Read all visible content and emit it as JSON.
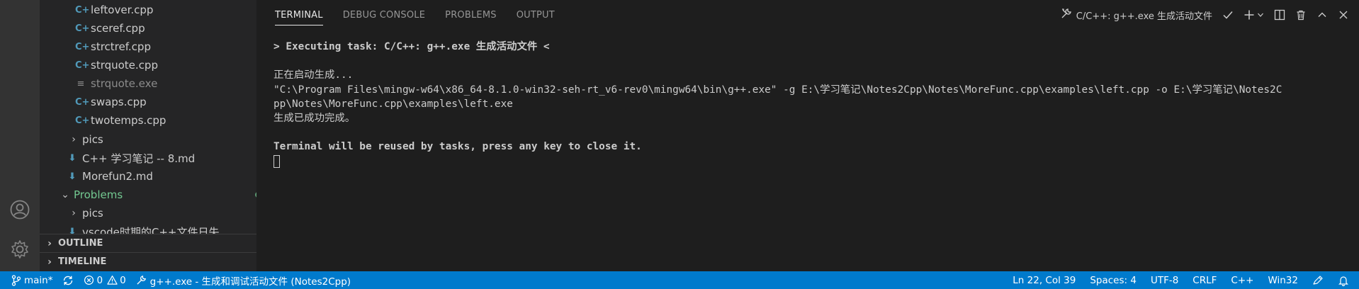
{
  "explorer": {
    "items": [
      {
        "label": "leftover.cpp",
        "icon": "cpp-file-icon",
        "level": 2
      },
      {
        "label": "sceref.cpp",
        "icon": "cpp-file-icon",
        "level": 2
      },
      {
        "label": "strctref.cpp",
        "icon": "cpp-file-icon",
        "level": 2
      },
      {
        "label": "strquote.cpp",
        "icon": "cpp-file-icon",
        "level": 2
      },
      {
        "label": "strquote.exe",
        "icon": "exe-file-icon",
        "level": 2
      },
      {
        "label": "swaps.cpp",
        "icon": "cpp-file-icon",
        "level": 2
      },
      {
        "label": "twotemps.cpp",
        "icon": "cpp-file-icon",
        "level": 2
      },
      {
        "label": "pics",
        "icon": "chevron-right-icon",
        "level": 1
      },
      {
        "label": "C++ 学习笔记 -- 8.md",
        "icon": "markdown-file-icon",
        "level": 1
      },
      {
        "label": "Morefun2.md",
        "icon": "markdown-file-icon",
        "level": 1
      },
      {
        "label": "Problems",
        "icon": "chevron-down-icon",
        "level": 0
      },
      {
        "label": "pics",
        "icon": "chevron-right-icon",
        "level": 1
      },
      {
        "label": "vscode时期的C++文件日失...",
        "icon": "markdown-file-icon",
        "level": 1
      }
    ],
    "outline_label": "OUTLINE",
    "timeline_label": "TIMELINE"
  },
  "panel": {
    "tabs": [
      {
        "label": "TERMINAL",
        "active": true
      },
      {
        "label": "DEBUG CONSOLE",
        "active": false
      },
      {
        "label": "PROBLEMS",
        "active": false
      },
      {
        "label": "OUTPUT",
        "active": false
      }
    ],
    "task_name": "C/C++: g++.exe 生成活动文件"
  },
  "terminal": {
    "lines": [
      "> Executing task: C/C++: g++.exe 生成活动文件 <",
      "",
      "正在启动生成...",
      "\"C:\\Program Files\\mingw-w64\\x86_64-8.1.0-win32-seh-rt_v6-rev0\\mingw64\\bin\\g++.exe\" -g E:\\学习笔记\\Notes2Cpp\\Notes\\MoreFunc.cpp\\examples\\left.cpp -o E:\\学习笔记\\Notes2C",
      "pp\\Notes\\MoreFunc.cpp\\examples\\left.exe",
      "生成已成功完成。",
      "",
      "Terminal will be reused by tasks, press any key to close it."
    ]
  },
  "statusbar": {
    "branch": "main*",
    "errors": "0",
    "warnings": "0",
    "task": "g++.exe - 生成和调试活动文件 (Notes2Cpp)",
    "position": "Ln 22, Col 39",
    "spaces": "Spaces: 4",
    "encoding": "UTF-8",
    "eol": "CRLF",
    "language": "C++",
    "platform": "Win32"
  },
  "colors": {
    "statusbar_bg": "#007acc",
    "cpp_icon": "#519aba",
    "md_icon": "#519aba",
    "problems_folder": "#73c991"
  }
}
